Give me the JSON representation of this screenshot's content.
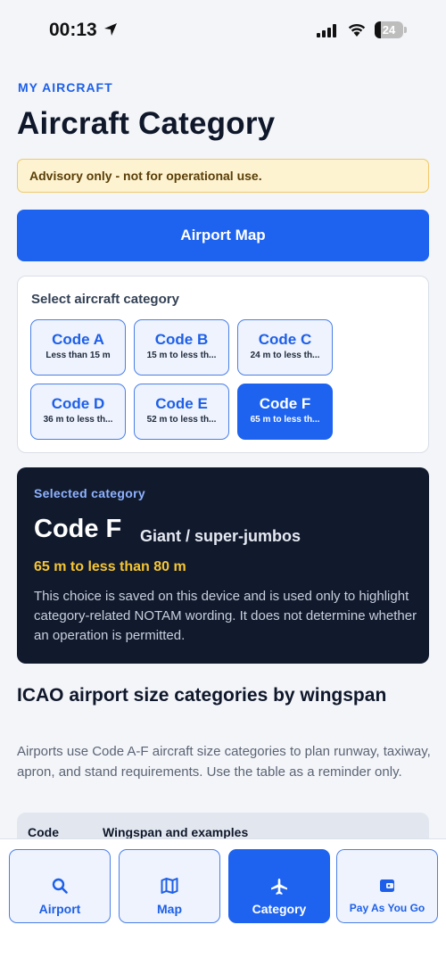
{
  "status_bar": {
    "time": "00:13",
    "battery": "24"
  },
  "header": {
    "eyebrow": "MY AIRCRAFT",
    "title": "Aircraft Category"
  },
  "advisory": "Advisory only - not for operational use.",
  "primary_button": "Airport Map",
  "selector": {
    "label": "Select aircraft category",
    "chips": [
      {
        "code": "Code A",
        "range": "Less than 15 m",
        "selected": false
      },
      {
        "code": "Code B",
        "range": "15 m to less th...",
        "selected": false
      },
      {
        "code": "Code C",
        "range": "24 m to less th...",
        "selected": false
      },
      {
        "code": "Code D",
        "range": "36 m to less th...",
        "selected": false
      },
      {
        "code": "Code E",
        "range": "52 m to less th...",
        "selected": false
      },
      {
        "code": "Code F",
        "range": "65 m to less th...",
        "selected": true
      }
    ]
  },
  "selected": {
    "eyebrow": "Selected category",
    "code": "Code F",
    "subtitle": "Giant / super-jumbos",
    "range": "65 m to less than 80 m",
    "body": "This choice is saved on this device and is used only to highlight category-related NOTAM wording. It does not determine whether an operation is permitted."
  },
  "section": {
    "title": "ICAO airport size categories by wingspan",
    "body": "Airports use Code A-F aircraft size categories to plan runway, taxiway, apron, and stand requirements. Use the table as a reminder only."
  },
  "table": {
    "col_code": "Code",
    "col_wingspan": "Wingspan and examples"
  },
  "tabs": [
    {
      "label": "Airport",
      "icon": "search-icon",
      "active": false
    },
    {
      "label": "Map",
      "icon": "map-icon",
      "active": false
    },
    {
      "label": "Category",
      "icon": "airplane-icon",
      "active": true
    },
    {
      "label": "Pay As You Go",
      "icon": "wallet-icon",
      "active": false
    }
  ],
  "colors": {
    "accent": "#1d63f0",
    "dark_card": "#111a2d",
    "highlight": "#f5c531",
    "advisory_bg": "#fdf3d0"
  }
}
